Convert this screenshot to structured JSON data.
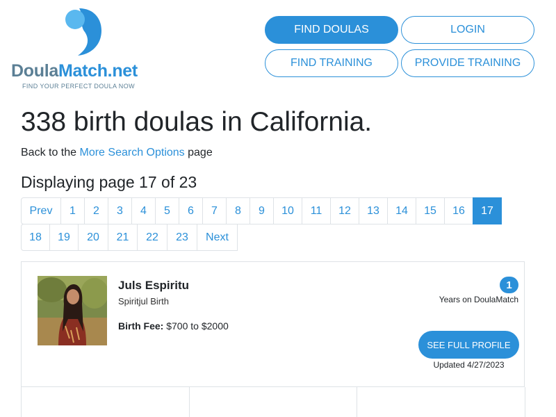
{
  "brand": {
    "name_part1": "Doula",
    "name_part2": "Match.net",
    "tagline": "FIND YOUR PERFECT DOULA NOW",
    "color_primary": "#2b90d9",
    "color_secondary": "#5b7f95"
  },
  "nav": {
    "find_doulas": "FIND DOULAS",
    "login": "LOGIN",
    "find_training": "FIND TRAINING",
    "provide_training": "PROVIDE TRAINING"
  },
  "main": {
    "title": "338 birth doulas in California.",
    "back_prefix": "Back to the ",
    "back_link": "More Search Options",
    "back_suffix": " page",
    "displaying": "Displaying page 17 of 23"
  },
  "pagination": {
    "row1": [
      {
        "label": "Prev",
        "width": 58
      },
      {
        "label": "1",
        "width": 35
      },
      {
        "label": "2",
        "width": 35
      },
      {
        "label": "3",
        "width": 35
      },
      {
        "label": "4",
        "width": 35
      },
      {
        "label": "5",
        "width": 35
      },
      {
        "label": "6",
        "width": 35
      },
      {
        "label": "7",
        "width": 35
      },
      {
        "label": "8",
        "width": 35
      },
      {
        "label": "9",
        "width": 35
      },
      {
        "label": "10",
        "width": 42
      },
      {
        "label": "11",
        "width": 42
      },
      {
        "label": "12",
        "width": 42
      },
      {
        "label": "13",
        "width": 42
      },
      {
        "label": "14",
        "width": 42
      },
      {
        "label": "15",
        "width": 42
      },
      {
        "label": "16",
        "width": 42
      },
      {
        "label": "17",
        "width": 42
      }
    ],
    "row2": [
      {
        "label": "18",
        "width": 42
      },
      {
        "label": "19",
        "width": 42
      },
      {
        "label": "20",
        "width": 44
      },
      {
        "label": "21",
        "width": 43
      },
      {
        "label": "22",
        "width": 44
      },
      {
        "label": "23",
        "width": 44
      },
      {
        "label": "Next",
        "width": 59
      }
    ],
    "active": "17"
  },
  "listing": {
    "name": "Juls Espiritu",
    "business": "Spiritjul Birth",
    "fee_label": "Birth Fee:",
    "fee_value": " $700 to $2000",
    "years": "1",
    "years_label": "Years on DoulaMatch",
    "profile_button": "SEE FULL PROFILE",
    "updated": "Updated 4/27/2023"
  }
}
